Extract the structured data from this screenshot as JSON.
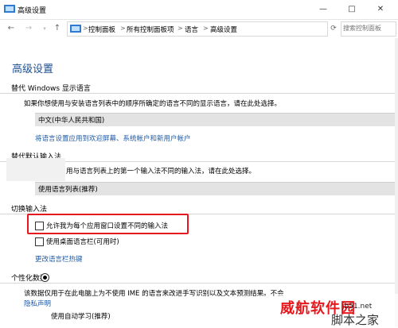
{
  "window": {
    "title": "高级设置",
    "minimize_glyph": "—",
    "maximize_glyph": "□",
    "close_glyph": "✕"
  },
  "address": {
    "crumbs": [
      "控制面板",
      "所有控制面板项",
      "语言",
      "高级设置"
    ],
    "separator": ">",
    "search_placeholder": "搜索控制面板"
  },
  "page": {
    "title": "高级设置",
    "sections": {
      "display_lang": {
        "title": "替代 Windows 显示语言",
        "desc": "如果你想使用与安装语言列表中的顺序所确定的语言不同的显示语言，请在此处选择。",
        "value": "中文(中华人民共和国)",
        "link": "将语言设置应用到欢迎屏幕、系统帐户和新用户帐户"
      },
      "input_method": {
        "title": "替代默认输入法",
        "desc": "用与语言列表上的第一个输入法不同的输入法，请在此处选择。",
        "value": "使用语言列表(推荐)"
      },
      "switch_input": {
        "title": "切换输入法",
        "check1": "允许我为每个应用窗口设置不同的输入法",
        "check2": "使用桌面语言栏(可用时)",
        "link": "更改语言栏热键"
      },
      "personalize": {
        "title": "个性化数据",
        "desc": "该数据仅用于在此电脑上为不使用 IME 的语言来改进手写识别以及文本预测结果。不会",
        "link": "隐私声明",
        "radio": "使用自动学习(推荐)"
      }
    }
  },
  "watermark": {
    "main": "威航软件园",
    "sub": "脚本之家",
    "small": "jb51.net"
  },
  "colors": {
    "accent": "#1e4f91",
    "link": "#1e5aa8",
    "highlight": "#e5181d"
  }
}
